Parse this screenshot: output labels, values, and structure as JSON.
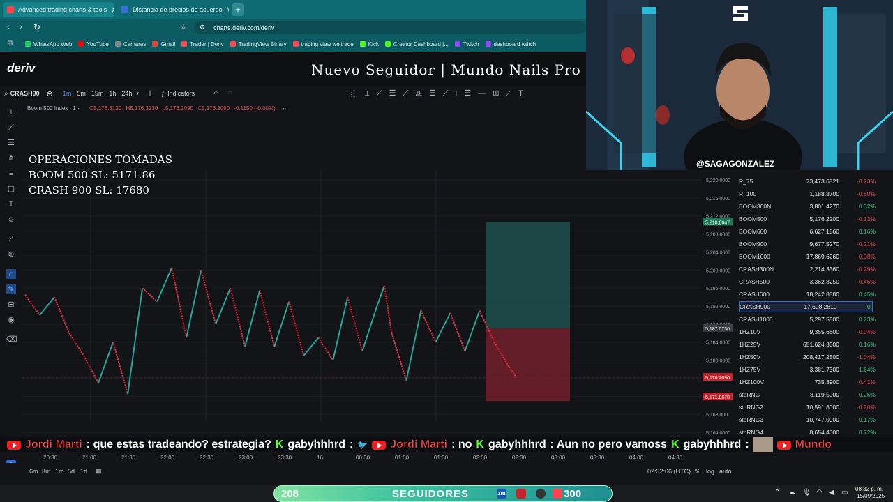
{
  "browser": {
    "tabs": [
      {
        "title": "Advanced trading charts & tools",
        "active": true
      },
      {
        "title": "Distancia de precios de acuerdo | W",
        "active": false
      }
    ],
    "url": "charts.deriv.com/deriv",
    "bookmarks": [
      "WhatsApp Web",
      "YouTube",
      "Camaras",
      "Gmail",
      "Trader | Deriv",
      "TradingView Binary",
      "trading view weltrade",
      "Kick",
      "Creator Dashboard |...",
      "Twitch",
      "dashboard twitch"
    ]
  },
  "app": {
    "logo": "deriv",
    "overlay_title": "Nuevo Seguidor | Mundo Nails Pro",
    "symbol_search": "CRASH90",
    "timeframes": [
      "1m",
      "5m",
      "15m",
      "1h",
      "24h"
    ],
    "active_timeframe": "1m",
    "indicators_label": "Indicators",
    "chart_title": "Boom 500 Index · 1 ·",
    "ohlc": {
      "o": "O5,176.3130",
      "h": "H5,176.3130",
      "l": "L5,176.2090",
      "c": "C5,176.2090",
      "chg": "-0.1150 (-0.00%)"
    }
  },
  "operations": {
    "line1": "OPERACIONES TOMADAS",
    "line2": "BOOM 500 SL: 5171.86",
    "line3": "CRASH 900 SL: 17680"
  },
  "chart_data": {
    "type": "line",
    "title": "Boom 500 Index",
    "x_ticks": [
      "20:30",
      "21:00",
      "21:30",
      "22:00",
      "22:30",
      "23:00",
      "23:30",
      "16",
      "00:30",
      "01:00",
      "01:30",
      "02:00",
      "02:30",
      "03:00",
      "03:30",
      "04:00",
      "04:30"
    ],
    "y_ticks": [
      "5,220.0000",
      "5,216.0000",
      "5,212.0000",
      "5,208.0000",
      "5,204.0000",
      "5,200.0000",
      "5,196.0000",
      "5,192.0000",
      "5,188.0000",
      "5,184.0000",
      "5,180.0000",
      "5,176.0000",
      "5,172.0000",
      "5,168.0000",
      "5,164.0000"
    ],
    "ylim": [
      5162,
      5222
    ],
    "x": [
      0,
      4,
      8,
      12,
      16,
      20,
      24,
      28,
      32,
      36,
      40,
      44,
      48,
      52,
      56,
      60,
      64,
      68,
      72,
      76,
      80,
      84,
      88,
      92,
      96,
      98,
      100,
      104,
      108,
      112,
      116,
      120,
      124,
      128,
      132,
      134
    ],
    "values": [
      5194.5,
      5190.0,
      5194.0,
      5186.0,
      5181.0,
      5175.0,
      5184.0,
      5172.5,
      5196.0,
      5193.0,
      5200.5,
      5185.0,
      5200.0,
      5188.0,
      5196.0,
      5183.0,
      5195.5,
      5183.0,
      5193.0,
      5181.0,
      5185.0,
      5180.0,
      5194.0,
      5182.0,
      5192.0,
      5196.5,
      5186.0,
      5175.5,
      5191.0,
      5184.0,
      5190.5,
      5182.0,
      5191.0,
      5184.0,
      5178.5,
      5176.209
    ],
    "labels": {
      "last_price": "5,176.2090",
      "tp": "5,210.6647",
      "sl": "5,171.8670",
      "entry": "5,187.0730"
    },
    "position": {
      "entry": 5187.073,
      "tp": 5210.6647,
      "sl": 5171.867
    },
    "colors": {
      "up": "#26a69a",
      "down": "#ef2b35",
      "tp_zone": "#1f4c49",
      "sl_zone": "#6b1e2a"
    }
  },
  "watchlist": [
    {
      "symbol": "R_75",
      "price": "73,473.6521",
      "change": "-0.23%",
      "up": false
    },
    {
      "symbol": "R_100",
      "price": "1,188.8700",
      "change": "-0.60%",
      "up": false
    },
    {
      "symbol": "BOOM300N",
      "price": "3,801.4270",
      "change": "0.32%",
      "up": true
    },
    {
      "symbol": "BOOM500",
      "price": "5,176.2200",
      "change": "-0.13%",
      "up": false
    },
    {
      "symbol": "BOOM600",
      "price": "6,627.1860",
      "change": "0.16%",
      "up": true
    },
    {
      "symbol": "BOOM900",
      "price": "9,677.5270",
      "change": "-0.21%",
      "up": false
    },
    {
      "symbol": "BOOM1000",
      "price": "17,869.6260",
      "change": "-0.08%",
      "up": false
    },
    {
      "symbol": "CRASH300N",
      "price": "2,214.3360",
      "change": "-0.29%",
      "up": false
    },
    {
      "symbol": "CRASH500",
      "price": "3,362.8250",
      "change": "-0.46%",
      "up": false
    },
    {
      "symbol": "CRASH600",
      "price": "18,242.8580",
      "change": "0.45%",
      "up": true
    },
    {
      "symbol": "CRASH900",
      "price": "17,608.2810",
      "change": "0.",
      "up": true,
      "selected": true
    },
    {
      "symbol": "CRASH1000",
      "price": "5,297.5500",
      "change": "0.23%",
      "up": true
    },
    {
      "symbol": "1HZ10V",
      "price": "9,355.6600",
      "change": "-0.04%",
      "up": false
    },
    {
      "symbol": "1HZ25V",
      "price": "651,624.3300",
      "change": "0.16%",
      "up": true
    },
    {
      "symbol": "1HZ50V",
      "price": "208,417.2500",
      "change": "-1.04%",
      "up": false
    },
    {
      "symbol": "1HZ75V",
      "price": "3,381.7300",
      "change": "1.64%",
      "up": true
    },
    {
      "symbol": "1HZ100V",
      "price": "735.3900",
      "change": "-0.41%",
      "up": false
    },
    {
      "symbol": "stpRNG",
      "price": "8,119.5000",
      "change": "0.26%",
      "up": true
    },
    {
      "symbol": "stpRNG2",
      "price": "10,591.8000",
      "change": "-0.20%",
      "up": false
    },
    {
      "symbol": "stpRNG3",
      "price": "10,747.0000",
      "change": "0.17%",
      "up": true
    },
    {
      "symbol": "stpRNG4",
      "price": "8,654.4000",
      "change": "0.72%",
      "up": true
    }
  ],
  "stream": {
    "handle": "@SAGAGONZALEZ",
    "chat": [
      {
        "platform": "youtube",
        "user": "Jordi Marti",
        "msg": ": que estas tradeando? estrategia?"
      },
      {
        "platform": "kick",
        "user": "gabyhhhrd",
        "msg": ":"
      },
      {
        "platform": "youtube",
        "user": "Jordi Marti",
        "msg": ": no"
      },
      {
        "platform": "kick",
        "user": "gabyhhhrd",
        "msg": ": Aun no pero vamoss"
      },
      {
        "platform": "kick",
        "user": "gabyhhhrd",
        "msg": ":"
      },
      {
        "platform": "youtube",
        "user": "Mundo",
        "msg": ""
      }
    ],
    "followers_count": "208",
    "followers_label": "SEGUIDORES",
    "followers_goal": "300"
  },
  "bottom": {
    "ranges": [
      "6m",
      "3m",
      "1m",
      "5d",
      "1d"
    ],
    "clock": "02:32:06 (UTC)",
    "scale_opts": [
      "%",
      "log",
      "auto"
    ]
  },
  "taskbar": {
    "time": "08:32 p. m.",
    "date": "15/09/2025"
  }
}
